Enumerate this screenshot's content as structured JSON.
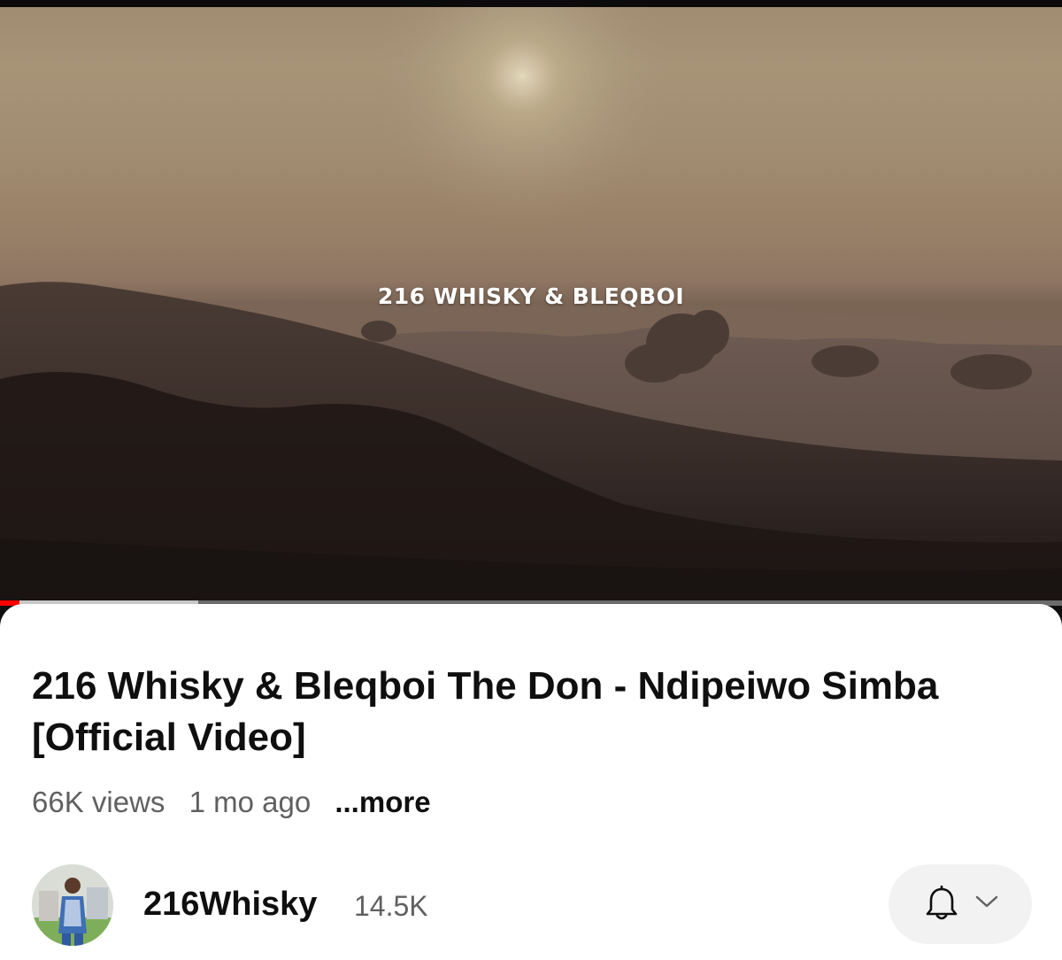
{
  "video": {
    "overlay_text": "216 WHISKY & BLEQBOI",
    "progress": 0.018,
    "buffered": 0.186
  },
  "title": "216 Whisky & Bleqboi The Don - Ndipeiwo Simba [Official Video]",
  "meta": {
    "views": "66K views",
    "age": "1 mo ago",
    "more_label": "...more"
  },
  "channel": {
    "name": "216Whisky",
    "subscribers": "14.5K"
  },
  "icons": {
    "notification": "bell-icon",
    "dropdown": "chevron-down-icon"
  },
  "colors": {
    "progress": "#ff0000",
    "buffer": "#c7c7c7"
  }
}
